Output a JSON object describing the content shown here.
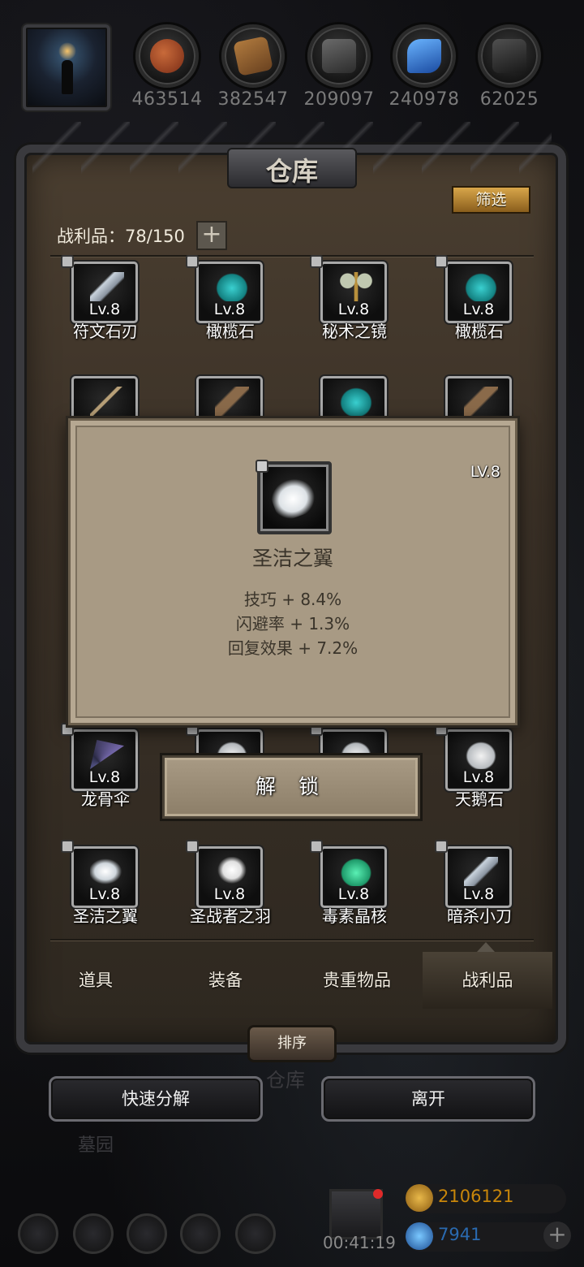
{
  "resources": [
    {
      "name": "meat",
      "value": "463514"
    },
    {
      "name": "wood",
      "value": "382547"
    },
    {
      "name": "iron",
      "value": "209097"
    },
    {
      "name": "crystal",
      "value": "240978"
    },
    {
      "name": "coal",
      "value": "62025"
    }
  ],
  "panel": {
    "title": "仓库",
    "filter_label": "筛选",
    "loot_count": "战利品：78/150",
    "plus_label": "+"
  },
  "items_row1": [
    {
      "lv": "Lv.8",
      "name": "符文石刃",
      "icon": "knife-icon"
    },
    {
      "lv": "Lv.8",
      "name": "橄榄石",
      "icon": "olivine-icon"
    },
    {
      "lv": "Lv.8",
      "name": "秘术之镜",
      "icon": "mirror-icon"
    },
    {
      "lv": "Lv.8",
      "name": "橄榄石",
      "icon": "olivine-icon"
    }
  ],
  "items_row3": [
    {
      "lv": "Lv.8",
      "name": "龙骨伞",
      "icon": "umbrella-icon"
    },
    {
      "lv": "Lv.8",
      "name": "天鹅石",
      "icon": "swan-stone-icon"
    }
  ],
  "items_row4": [
    {
      "lv": "Lv.8",
      "name": "圣洁之翼",
      "icon": "wing-icon"
    },
    {
      "lv": "Lv.8",
      "name": "圣战者之羽",
      "icon": "feather-icon"
    },
    {
      "lv": "Lv.8",
      "name": "毒素晶核",
      "icon": "toxic-core-icon"
    },
    {
      "lv": "Lv.8",
      "name": "暗杀小刀",
      "icon": "dagger-icon"
    }
  ],
  "tabs": [
    {
      "label": "道具"
    },
    {
      "label": "装备"
    },
    {
      "label": "贵重物品"
    },
    {
      "label": "战利品"
    }
  ],
  "sort_label": "排序",
  "bg_labels": {
    "warehouse": "仓库",
    "graveyard": "墓园"
  },
  "buttons": {
    "quick_decompose": "快速分解",
    "leave": "离开",
    "unlock": "解 锁"
  },
  "dialog": {
    "level": "LV.8",
    "name": "圣洁之翼",
    "stats": [
      "技巧 + 8.4%",
      "闪避率 + 1.3%",
      "回复效果 + 7.2%"
    ]
  },
  "hud": {
    "timer": "00:41:19",
    "gold": "2106121",
    "gems": "7941"
  },
  "colors": {
    "accent_gold": "#d8a64a",
    "gold_text": "#c8860a",
    "gem_text": "#2a6ab0"
  }
}
